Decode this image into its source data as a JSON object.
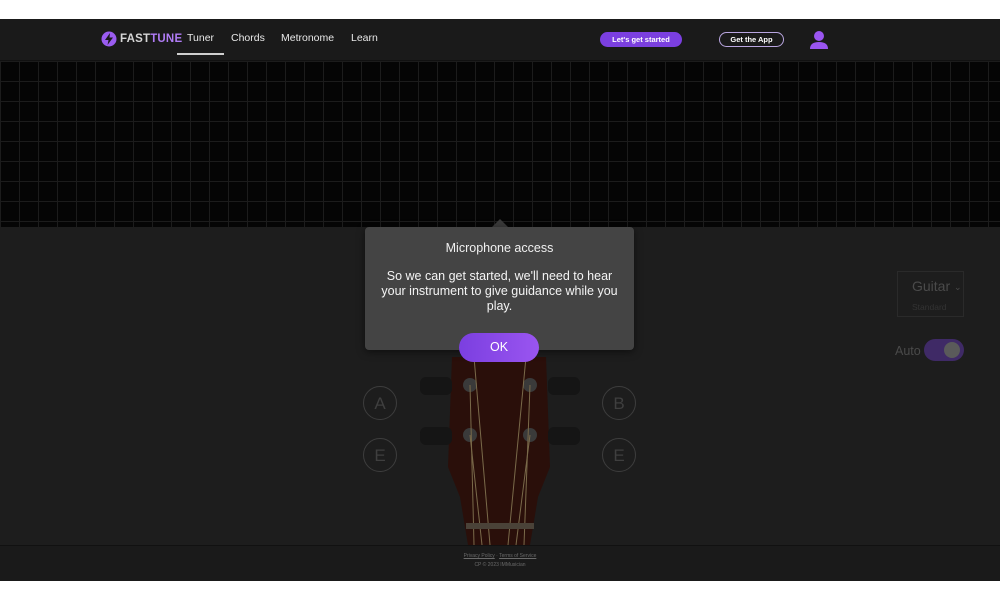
{
  "header": {
    "logo": {
      "part1": "FAST",
      "part2": "TUNE"
    },
    "nav": [
      {
        "label": "Tuner",
        "active": true
      },
      {
        "label": "Chords",
        "active": false
      },
      {
        "label": "Metronome",
        "active": false
      },
      {
        "label": "Learn",
        "active": false
      }
    ],
    "cta_start": "Let's get started",
    "cta_app": "Get the App",
    "user_icon": "user-icon"
  },
  "tuner": {
    "strings_left": [
      "A",
      "E"
    ],
    "strings_right": [
      "B",
      "E"
    ],
    "instrument": {
      "name": "Guitar",
      "tuning": "Standard"
    },
    "auto_label": "Auto",
    "auto_enabled": true
  },
  "modal": {
    "title": "Microphone access",
    "body": "So we can get started, we'll need to hear your instrument to give guidance while you play.",
    "ok_label": "OK"
  },
  "footer": {
    "privacy": "Privacy Policy",
    "separator": "·",
    "terms": "Terms of Service",
    "copyright": "CP © 2023 IMMusician"
  },
  "colors": {
    "accent": "#7b3fe0",
    "logo_accent": "#b07cf5",
    "background": "#1f1f1f",
    "modal": "#444444"
  }
}
